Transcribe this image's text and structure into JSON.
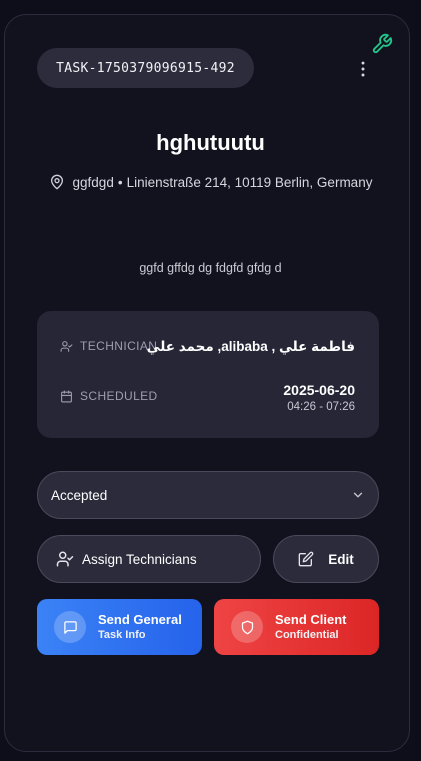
{
  "header": {
    "task_id": "TASK-1750379096915-492"
  },
  "task": {
    "title": "hghutuutu",
    "location_name": "ggfdgd",
    "separator": "•",
    "address": "Linienstraße 214, 10119 Berlin, Germany",
    "description": "ggfd gffdg dg fdgfd gfdg d"
  },
  "info": {
    "technician_label": "TECHNICIAN",
    "technician_value": "فاطمة علي , alibaba, محمد علي",
    "scheduled_label": "SCHEDULED",
    "scheduled_date": "2025-06-20",
    "scheduled_time": "04:26 - 07:26"
  },
  "status": {
    "selected": "Accepted"
  },
  "buttons": {
    "assign": "Assign Technicians",
    "edit": "Edit",
    "send_general_line1": "Send General",
    "send_general_line2": "Task Info",
    "send_client_line1": "Send Client",
    "send_client_line2": "Confidential"
  },
  "colors": {
    "background": "#0e0e1a",
    "card": "#12121f",
    "accent_green": "#22c58a",
    "send_general": "#3b82f6",
    "send_client": "#ef4444"
  },
  "icons": {
    "tool": "wrench-icon",
    "menu": "more-vertical-icon",
    "location": "map-pin-icon",
    "technician": "user-check-icon",
    "scheduled": "calendar-icon",
    "dropdown": "chevron-down-icon",
    "assign": "user-check-icon",
    "edit": "edit-icon",
    "send_general": "message-square-icon",
    "send_client": "shield-icon"
  }
}
